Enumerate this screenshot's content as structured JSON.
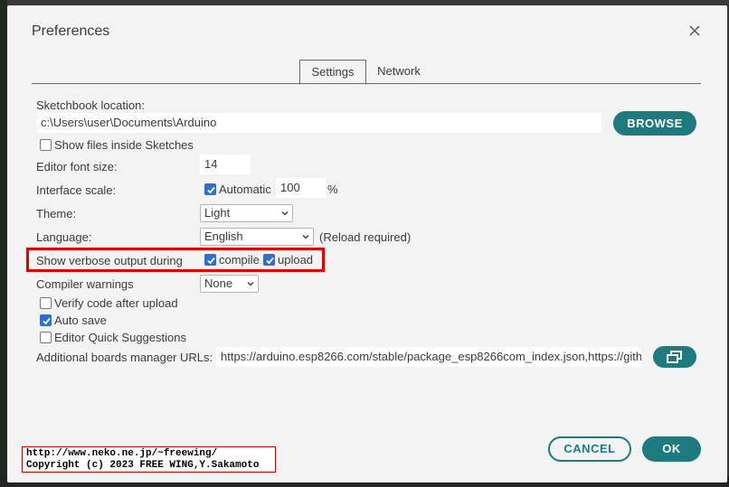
{
  "dialog": {
    "title": "Preferences",
    "tabs": [
      {
        "label": "Settings",
        "active": true
      },
      {
        "label": "Network",
        "active": false
      }
    ]
  },
  "settings": {
    "sketchbook_label": "Sketchbook location:",
    "sketchbook_value": "c:\\Users\\user\\Documents\\Arduino",
    "browse_label": "BROWSE",
    "show_files_label": "Show files inside Sketches",
    "show_files_checked": false,
    "font_size_label": "Editor font size:",
    "font_size_value": "14",
    "interface_scale_label": "Interface scale:",
    "automatic_label": "Automatic",
    "automatic_checked": true,
    "scale_value": "100",
    "scale_unit": "%",
    "theme_label": "Theme:",
    "theme_value": "Light",
    "language_label": "Language:",
    "language_value": "English",
    "reload_note": "(Reload required)",
    "verbose_label": "Show verbose output during",
    "compile_label": "compile",
    "compile_checked": true,
    "upload_label": "upload",
    "upload_checked": true,
    "compiler_warnings_label": "Compiler warnings",
    "compiler_warnings_value": "None",
    "verify_label": "Verify code after upload",
    "verify_checked": false,
    "autosave_label": "Auto save",
    "autosave_checked": true,
    "quick_suggestions_label": "Editor Quick Suggestions",
    "quick_suggestions_checked": false,
    "boards_urls_label": "Additional boards manager URLs:",
    "boards_urls_value": "https://arduino.esp8266.com/stable/package_esp8266com_index.json,https://gith"
  },
  "footer": {
    "cancel_label": "CANCEL",
    "ok_label": "OK"
  },
  "overlay": {
    "copyright_line1": "http://www.neko.ne.jp/~freewing/",
    "copyright_line2": "Copyright (c) 2023 FREE WING,Y.Sakamoto"
  },
  "colors": {
    "accent": "#1d7b7f",
    "checkbox": "#2f6fd0",
    "highlight": "#e00000"
  }
}
